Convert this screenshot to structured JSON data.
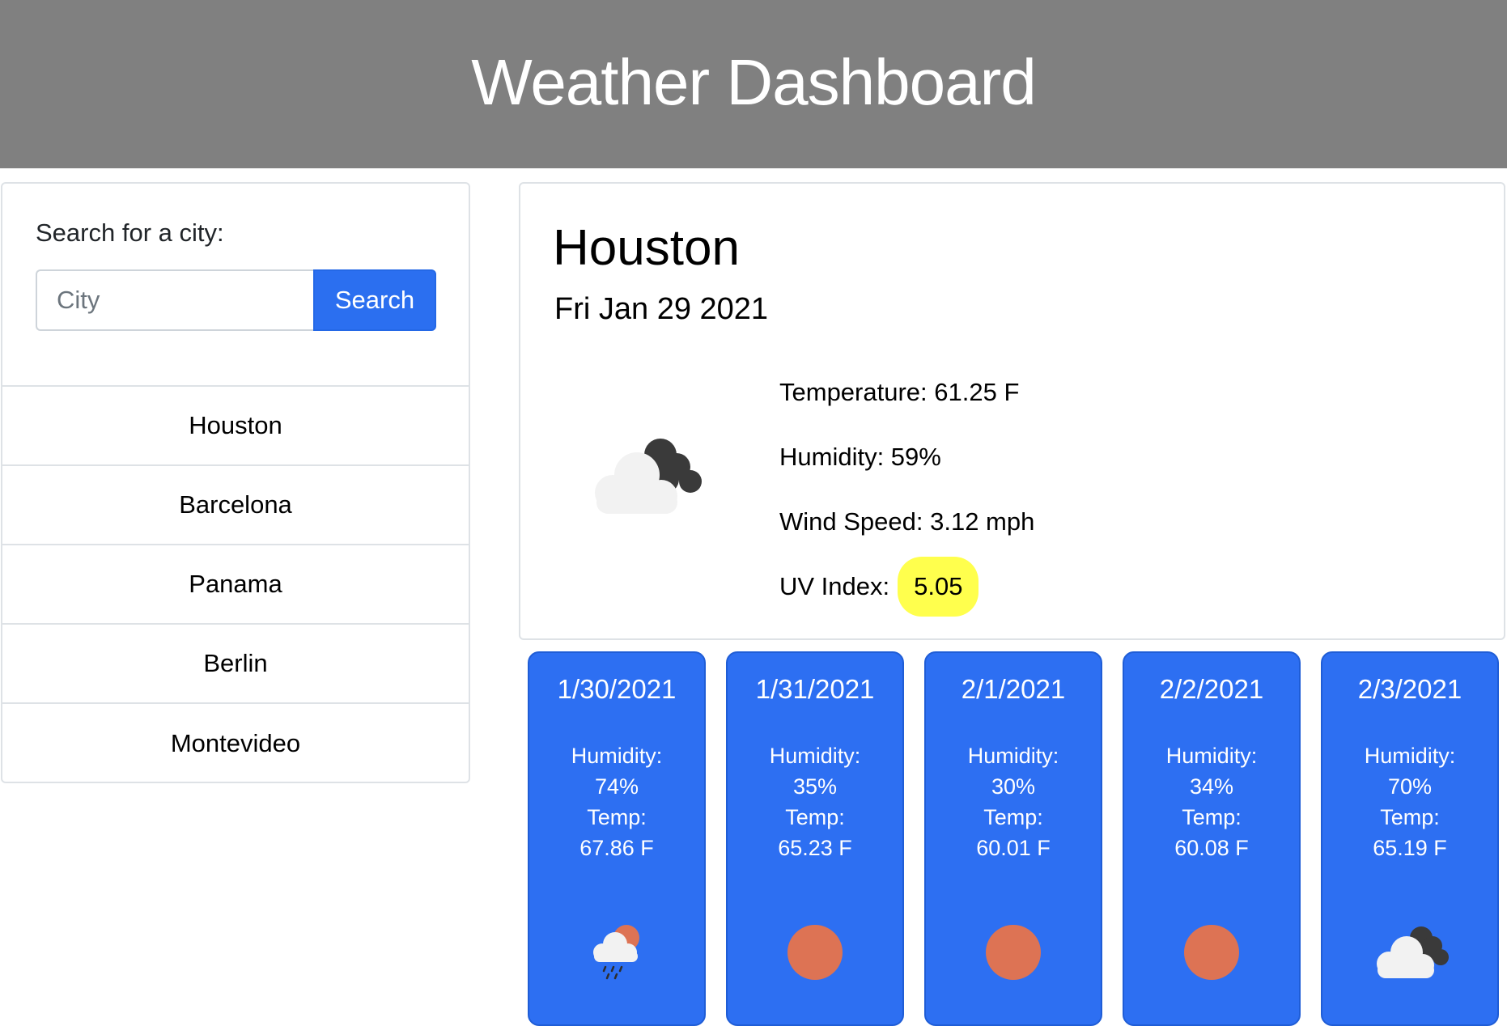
{
  "header": {
    "title": "Weather Dashboard"
  },
  "sidebar": {
    "search_label": "Search for a city:",
    "input_placeholder": "City",
    "input_value": "",
    "search_button": "Search",
    "cities": [
      "Houston",
      "Barcelona",
      "Panama",
      "Berlin",
      "Montevideo"
    ]
  },
  "current": {
    "city": "Houston",
    "date": "Fri Jan 29 2021",
    "icon": "partly-cloudy-night-icon",
    "temperature": "Temperature: 61.25 F",
    "humidity": "Humidity: 59%",
    "wind": "Wind Speed: 3.12 mph",
    "uv_label": "UV Index:",
    "uv_value": "5.05",
    "uv_color": "#ffff4d"
  },
  "forecast": [
    {
      "date": "1/30/2021",
      "humidity_label": "Humidity:",
      "humidity": "74%",
      "temp_label": "Temp:",
      "temp": "67.86 F",
      "icon": "rain-sun-icon"
    },
    {
      "date": "1/31/2021",
      "humidity_label": "Humidity:",
      "humidity": "35%",
      "temp_label": "Temp:",
      "temp": "65.23 F",
      "icon": "sun-icon"
    },
    {
      "date": "2/1/2021",
      "humidity_label": "Humidity:",
      "humidity": "30%",
      "temp_label": "Temp:",
      "temp": "60.01 F",
      "icon": "sun-icon"
    },
    {
      "date": "2/2/2021",
      "humidity_label": "Humidity:",
      "humidity": "34%",
      "temp_label": "Temp:",
      "temp": "60.08 F",
      "icon": "sun-icon"
    },
    {
      "date": "2/3/2021",
      "humidity_label": "Humidity:",
      "humidity": "70%",
      "temp_label": "Temp:",
      "temp": "65.19 F",
      "icon": "partly-cloudy-night-icon"
    }
  ],
  "colors": {
    "header_bg": "#808080",
    "accent": "#2b6ff0",
    "forecast_bg": "#2d6ff2",
    "sun": "#dd7354"
  }
}
